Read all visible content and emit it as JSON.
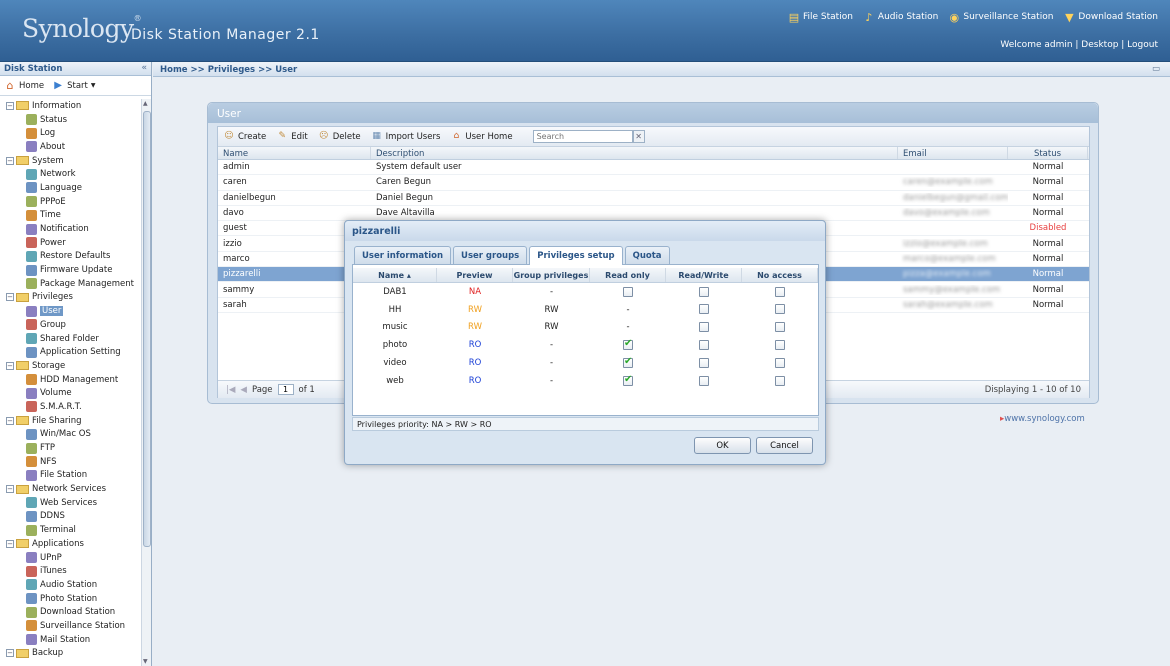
{
  "header": {
    "brand": "Synology",
    "product": "Disk Station Manager 2.1",
    "quick_links": [
      "File Station",
      "Audio Station",
      "Surveillance Station",
      "Download Station"
    ],
    "welcome": "Welcome admin | Desktop | Logout"
  },
  "left_panel": {
    "title": "Disk Station",
    "home_label": "Home",
    "start_label": "Start",
    "tree": [
      {
        "label": "Information",
        "level": 0
      },
      {
        "label": "Status",
        "level": 1
      },
      {
        "label": "Log",
        "level": 1
      },
      {
        "label": "About",
        "level": 1
      },
      {
        "label": "System",
        "level": 0
      },
      {
        "label": "Network",
        "level": 1
      },
      {
        "label": "Language",
        "level": 1
      },
      {
        "label": "PPPoE",
        "level": 1
      },
      {
        "label": "Time",
        "level": 1
      },
      {
        "label": "Notification",
        "level": 1
      },
      {
        "label": "Power",
        "level": 1
      },
      {
        "label": "Restore Defaults",
        "level": 1
      },
      {
        "label": "Firmware Update",
        "level": 1
      },
      {
        "label": "Package Management",
        "level": 1
      },
      {
        "label": "Privileges",
        "level": 0
      },
      {
        "label": "User",
        "level": 1,
        "selected": true
      },
      {
        "label": "Group",
        "level": 1
      },
      {
        "label": "Shared Folder",
        "level": 1
      },
      {
        "label": "Application Setting",
        "level": 1
      },
      {
        "label": "Storage",
        "level": 0
      },
      {
        "label": "HDD Management",
        "level": 1
      },
      {
        "label": "Volume",
        "level": 1
      },
      {
        "label": "S.M.A.R.T.",
        "level": 1
      },
      {
        "label": "File Sharing",
        "level": 0
      },
      {
        "label": "Win/Mac OS",
        "level": 1
      },
      {
        "label": "FTP",
        "level": 1
      },
      {
        "label": "NFS",
        "level": 1
      },
      {
        "label": "File Station",
        "level": 1
      },
      {
        "label": "Network Services",
        "level": 0
      },
      {
        "label": "Web Services",
        "level": 1
      },
      {
        "label": "DDNS",
        "level": 1
      },
      {
        "label": "Terminal",
        "level": 1
      },
      {
        "label": "Applications",
        "level": 0
      },
      {
        "label": "UPnP",
        "level": 1
      },
      {
        "label": "iTunes",
        "level": 1
      },
      {
        "label": "Audio Station",
        "level": 1
      },
      {
        "label": "Photo Station",
        "level": 1
      },
      {
        "label": "Download Station",
        "level": 1
      },
      {
        "label": "Surveillance Station",
        "level": 1
      },
      {
        "label": "Mail Station",
        "level": 1
      },
      {
        "label": "Backup",
        "level": 0
      }
    ]
  },
  "breadcrumb": "Home >> Privileges >> User",
  "user_panel": {
    "title": "User",
    "toolbar": [
      "Create",
      "Edit",
      "Delete",
      "Import Users",
      "User Home"
    ],
    "search_placeholder": "Search",
    "columns": [
      "Name",
      "Description",
      "Email",
      "Status"
    ],
    "rows": [
      {
        "name": "admin",
        "description": "System default user",
        "email": "",
        "status": "Normal"
      },
      {
        "name": "caren",
        "description": "Caren Begun",
        "email": "caren@example.com",
        "status": "Normal"
      },
      {
        "name": "danielbegun",
        "description": "Daniel Begun",
        "email": "danielbegun@gmail.com",
        "status": "Normal"
      },
      {
        "name": "davo",
        "description": "Dave Altavilla",
        "email": "davo@example.com",
        "status": "Normal"
      },
      {
        "name": "guest",
        "description": "",
        "email": "",
        "status": "Disabled"
      },
      {
        "name": "izzio",
        "description": "",
        "email": "izzio@example.com",
        "status": "Normal"
      },
      {
        "name": "marco",
        "description": "",
        "email": "marco@example.com",
        "status": "Normal"
      },
      {
        "name": "pizzarelli",
        "description": "",
        "email": "pizza@example.com",
        "status": "Normal",
        "selected": true
      },
      {
        "name": "sammy",
        "description": "",
        "email": "sammy@example.com",
        "status": "Normal"
      },
      {
        "name": "sarah",
        "description": "",
        "email": "sarah@example.com",
        "status": "Normal"
      }
    ],
    "pager_page_label": "Page",
    "pager_page": "1",
    "pager_of": "of 1",
    "displaying": "Displaying 1 - 10 of 10"
  },
  "synology_link": "www.synology.com",
  "dialog": {
    "title": "pizzarelli",
    "tabs": [
      "User information",
      "User groups",
      "Privileges setup",
      "Quota"
    ],
    "active_tab": 2,
    "columns": [
      "Name ▴",
      "Preview",
      "Group privileges",
      "Read only",
      "Read/Write",
      "No access"
    ],
    "rows": [
      {
        "name": "DAB1",
        "preview": "NA",
        "group": "-",
        "read_only": false,
        "read_write": false,
        "no_access": false
      },
      {
        "name": "HH",
        "preview": "RW",
        "group": "RW",
        "read_only": "-",
        "read_write": false,
        "no_access": false
      },
      {
        "name": "music",
        "preview": "RW",
        "group": "RW",
        "read_only": "-",
        "read_write": false,
        "no_access": false
      },
      {
        "name": "photo",
        "preview": "RO",
        "group": "-",
        "read_only": true,
        "read_write": false,
        "no_access": false
      },
      {
        "name": "video",
        "preview": "RO",
        "group": "-",
        "read_only": true,
        "read_write": false,
        "no_access": false
      },
      {
        "name": "web",
        "preview": "RO",
        "group": "-",
        "read_only": true,
        "read_write": false,
        "no_access": false
      }
    ],
    "priority_text": "Privileges priority: NA > RW > RO",
    "ok_label": "OK",
    "cancel_label": "Cancel"
  },
  "colors": {
    "header_blue": "#3d6fa3",
    "selection_blue": "#7ea4d1",
    "na_red": "#e02020",
    "rw_orange": "#f0a020",
    "ro_blue": "#1a3fd6",
    "disabled_red": "#e84040"
  }
}
